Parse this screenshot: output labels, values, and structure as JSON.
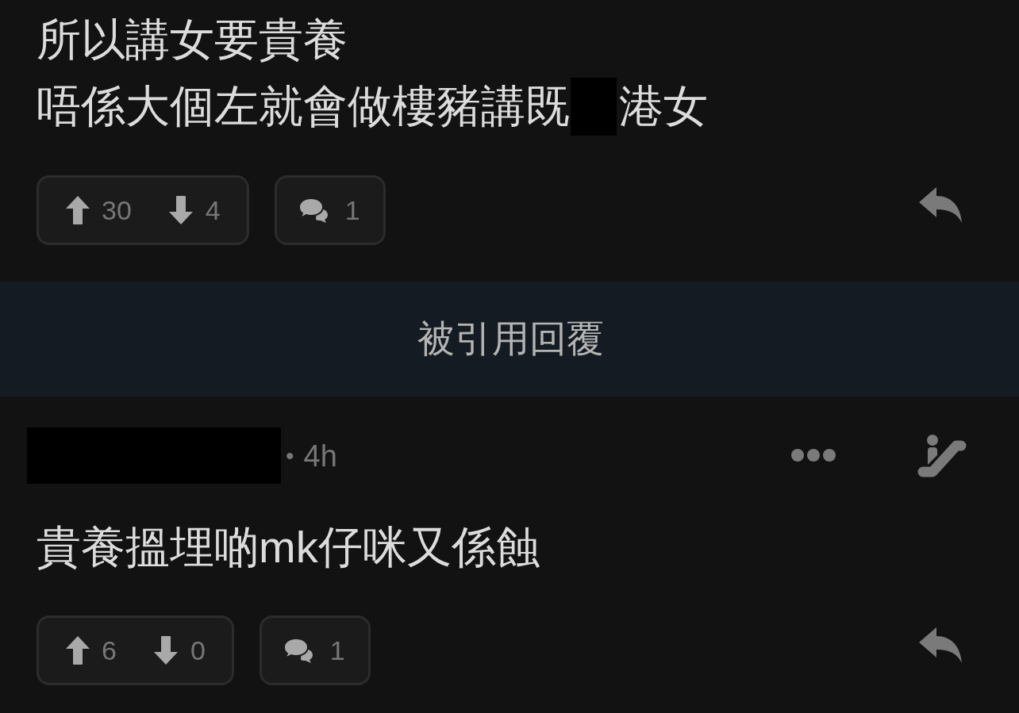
{
  "previous_post": {
    "body_lines": [
      [
        {
          "kind": "text",
          "text": "所以講女要貴養"
        }
      ],
      [
        {
          "kind": "text",
          "text": "唔係大個左就會做樓豬講既"
        },
        {
          "kind": "redacted"
        },
        {
          "kind": "text",
          "text": "港女"
        }
      ]
    ],
    "upvotes": "30",
    "downvotes": "4",
    "comments": "1"
  },
  "quote_banner": {
    "label": "被引用回覆"
  },
  "quoted_replies": [
    {
      "author_redacted": true,
      "separator": "•",
      "time": "4h",
      "body_lines": [
        [
          {
            "kind": "text",
            "text": "貴養搵埋啲mk仔咪又係蝕"
          }
        ]
      ],
      "upvotes": "6",
      "downvotes": "0",
      "comments": "1"
    }
  ]
}
